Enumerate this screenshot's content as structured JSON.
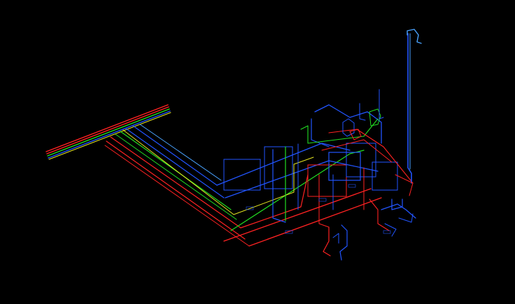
{
  "colors": {
    "background": "#000000",
    "supply": "#ff2222",
    "return": "#2255ff",
    "drain": "#22dd22",
    "vent": "#e6e622",
    "return_light": "#4aa3ff"
  },
  "pipe_systems": [
    {
      "key": "supply",
      "icon": "red-pipe-run"
    },
    {
      "key": "return",
      "icon": "blue-pipe-run"
    },
    {
      "key": "drain",
      "icon": "green-pipe-run"
    },
    {
      "key": "vent",
      "icon": "yellow-pipe-run"
    }
  ]
}
